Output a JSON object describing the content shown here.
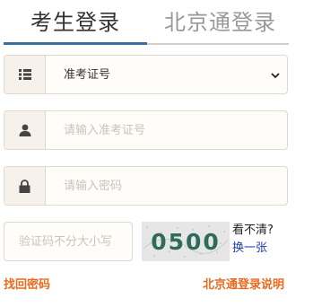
{
  "tabs": {
    "exam_login": "考生登录",
    "beijing_tong_login": "北京通登录"
  },
  "form": {
    "id_type": {
      "selected": "准考证号",
      "options": [
        "准考证号"
      ]
    },
    "exam_number": {
      "placeholder": "请输入准考证号",
      "value": ""
    },
    "password": {
      "placeholder": "请输入密码",
      "value": ""
    },
    "captcha": {
      "placeholder": "验证码不分大小写",
      "value": "",
      "image_text": "0500",
      "help_text": "看不清?",
      "refresh_link": "换一张"
    }
  },
  "links": {
    "forgot_password": "找回密码",
    "beijing_tong_help": "北京通登录说明"
  },
  "icons": {
    "id_type": "list-icon",
    "exam_number": "user-icon",
    "password": "lock-icon"
  },
  "colors": {
    "tab_active_underline": "#3a6fa4",
    "link_orange": "#e86a1f",
    "link_blue": "#1f3fae",
    "addon_bg": "#f6f1ea",
    "field_border": "#e0d9d0"
  }
}
